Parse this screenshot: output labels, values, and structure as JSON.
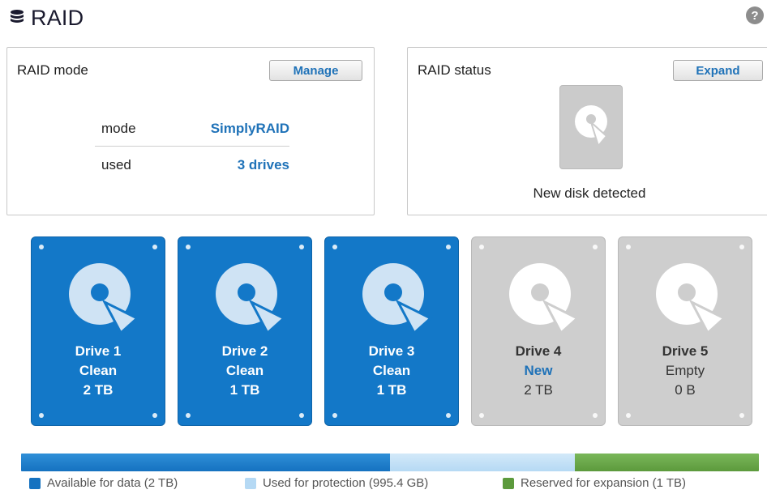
{
  "header": {
    "title": "RAID",
    "help_glyph": "?",
    "icon": "database-icon"
  },
  "raid_mode": {
    "title": "RAID mode",
    "manage_label": "Manage",
    "rows": [
      {
        "key": "mode",
        "value": "SimplyRAID"
      },
      {
        "key": "used",
        "value": "3 drives"
      }
    ]
  },
  "raid_status": {
    "title": "RAID status",
    "expand_label": "Expand",
    "message": "New disk detected"
  },
  "drives": [
    {
      "name": "Drive 1",
      "state": "Clean",
      "size": "2 TB",
      "color": "#1378c8"
    },
    {
      "name": "Drive 2",
      "state": "Clean",
      "size": "1 TB",
      "color": "#1378c8"
    },
    {
      "name": "Drive 3",
      "state": "Clean",
      "size": "1 TB",
      "color": "#1378c8"
    },
    {
      "name": "Drive 4",
      "state": "New",
      "size": "2 TB",
      "color": "#cecece"
    },
    {
      "name": "Drive 5",
      "state": "Empty",
      "size": "0 B",
      "color": "#cecece"
    }
  ],
  "capacity": {
    "segments": [
      {
        "label": "Available for data (2 TB)",
        "color": "#1572c0",
        "fraction": 0.5
      },
      {
        "label": "Used for protection (995.4 GB)",
        "color": "#b5d9f4",
        "fraction": 0.25
      },
      {
        "label": "Reserved for expansion (1 TB)",
        "color": "#5c9a3c",
        "fraction": 0.25
      }
    ]
  }
}
